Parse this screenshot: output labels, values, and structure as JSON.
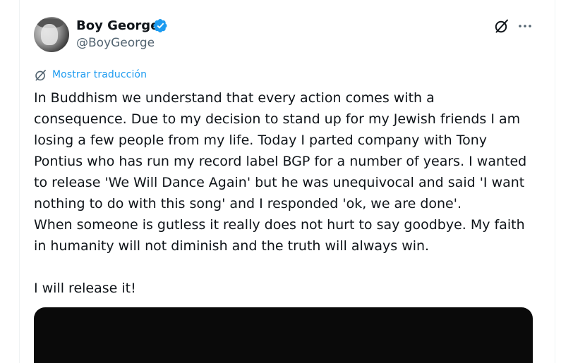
{
  "author": {
    "display_name": "Boy George",
    "handle": "@BoyGeorge",
    "avatar_icon": "user-avatar",
    "verified_icon": "verified-badge-icon",
    "verified_color": "#1d9bf0"
  },
  "header_actions": {
    "grok_icon": "grok-icon",
    "more_icon": "more-options-icon"
  },
  "translate": {
    "label": "Mostrar traducción",
    "icon": "translate-icon",
    "color": "#1d9bf0"
  },
  "tweet": {
    "lines": [
      "In Buddhism we understand that every action comes with a",
      "consequence. Due to my decision to stand up for my Jewish friends I am",
      "losing a few people from my life. Today I parted company with Tony",
      "Pontius who has run my record label BGP for a number of years. I wanted",
      "to release 'We Will Dance Again' but he was unequivocal and said 'I want",
      "nothing to do with this song' and I responded 'ok, we are done'.",
      "When someone is gutless it really does not hurt to say goodbye. My faith",
      "in humanity will not diminish and the truth will always win."
    ],
    "closing": "I will release it!"
  },
  "media": {
    "background_color": "#0a0a0a"
  }
}
